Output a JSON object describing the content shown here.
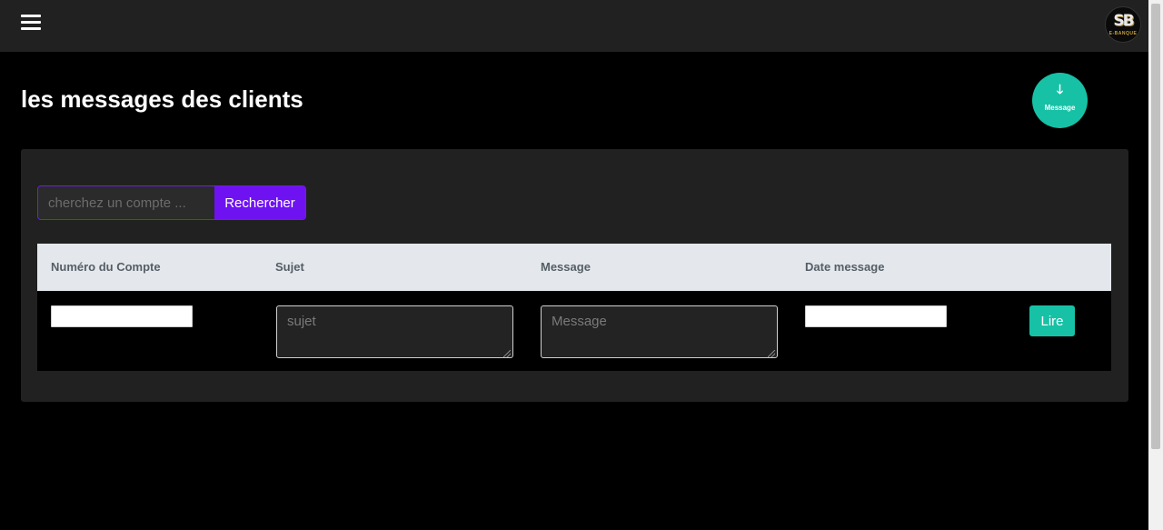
{
  "header": {
    "menu_icon": "hamburger-menu-icon",
    "logo": {
      "mark": "SB",
      "sub": "E-BANQUE"
    }
  },
  "page": {
    "title": "les messages des clients"
  },
  "fab": {
    "icon": "arrow-down-icon",
    "arrow": "🡓",
    "label": "Message",
    "color": "#17c1a6"
  },
  "search": {
    "placeholder": "cherchez un compte ...",
    "value": "",
    "button_label": "Rechercher",
    "button_color": "#6f12f2"
  },
  "table": {
    "columns": [
      "Numéro du Compte",
      "Sujet",
      "Message",
      "Date message"
    ],
    "row": {
      "account_value": "",
      "subject_placeholder": "sujet",
      "message_placeholder": "Message",
      "date_value": "",
      "action_label": "Lire"
    }
  }
}
